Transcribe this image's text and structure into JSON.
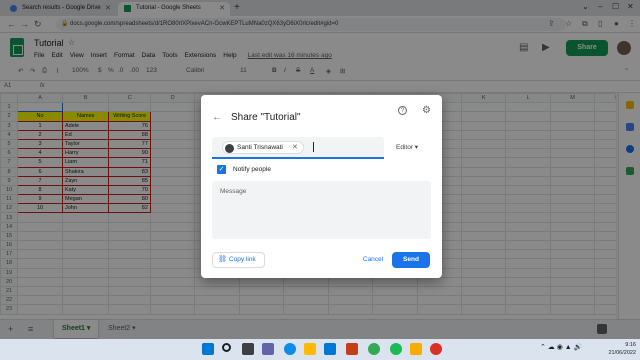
{
  "browser": {
    "tabs": [
      {
        "title": "Search results - Google Drive"
      },
      {
        "title": "Tutorial - Google Sheets"
      }
    ],
    "url": "docs.google.com/spreadsheets/d/1RO80rlXPixevACn-GcwKEPTLuMNa0zQX63yD6iX0rlc/edit#gid=0"
  },
  "sheets": {
    "title": "Tutorial",
    "menus": [
      "File",
      "Edit",
      "View",
      "Insert",
      "Format",
      "Data",
      "Tools",
      "Extensions",
      "Help"
    ],
    "last_edit": "Last edit was 16 minutes ago",
    "share_label": "Share",
    "toolbar": {
      "zoom": "100%",
      "currency": "$",
      "percent": "%",
      "decimals": ".0",
      "decimals2": ".00",
      "number_format": "123",
      "font": "Calibri",
      "font_size": "11"
    },
    "cell_ref": "A1",
    "columns": [
      "A",
      "B",
      "C",
      "D",
      "E",
      "F",
      "G",
      "H",
      "I",
      "J",
      "K",
      "L",
      "M",
      "N"
    ],
    "row_numbers": [
      "1",
      "2",
      "3",
      "4",
      "5",
      "6",
      "7",
      "8",
      "9",
      "10",
      "11",
      "12",
      "13",
      "14",
      "15",
      "16",
      "17",
      "18",
      "19",
      "20",
      "21",
      "22",
      "23"
    ],
    "table_headers": [
      "No",
      "Names",
      "Writing Score"
    ],
    "table_rows": [
      {
        "no": "1",
        "name": "Adele",
        "score": "76"
      },
      {
        "no": "2",
        "name": "Ed",
        "score": "88"
      },
      {
        "no": "3",
        "name": "Taylor",
        "score": "77"
      },
      {
        "no": "4",
        "name": "Harry",
        "score": "90"
      },
      {
        "no": "5",
        "name": "Liam",
        "score": "71"
      },
      {
        "no": "6",
        "name": "Shakira",
        "score": "83"
      },
      {
        "no": "7",
        "name": "Zayn",
        "score": "85"
      },
      {
        "no": "8",
        "name": "Katy",
        "score": "70"
      },
      {
        "no": "9",
        "name": "Megan",
        "score": "80"
      },
      {
        "no": "10",
        "name": "John",
        "score": "82"
      }
    ],
    "sheet_tabs": [
      "Sheet1",
      "Sheet2"
    ]
  },
  "dialog": {
    "title": "Share \"Tutorial\"",
    "chip_name": "Santi Trisnawati",
    "role": "Editor",
    "notify_label": "Notify people",
    "message_placeholder": "Message",
    "copy_link": "Copy link",
    "cancel": "Cancel",
    "send": "Send"
  },
  "taskbar": {
    "time": "9:16",
    "date": "21/06/2022"
  }
}
